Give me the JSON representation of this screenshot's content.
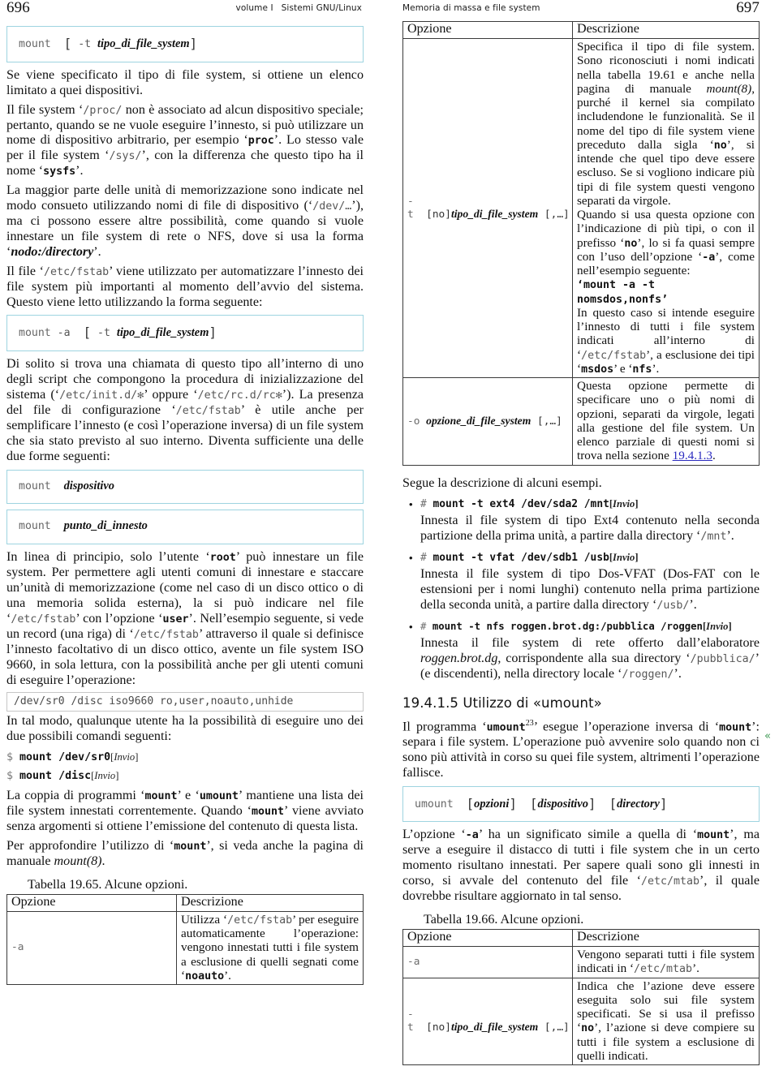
{
  "header": {
    "left_folio": "696",
    "left_title_1": "volume I",
    "left_title_2": "Sistemi GNU/Linux",
    "right_title": "Memoria di massa e file system",
    "right_folio": "697"
  },
  "left_column": {
    "syntax_1": {
      "cmd": "mount",
      "open_bracket": "[",
      "opt": "-t",
      "meta": "tipo_di_file_system",
      "close_bracket": "]"
    },
    "p1": "Se viene specificato il tipo di file system, si ottiene un elenco limitato a quei dispositivi.",
    "p2_a": "Il file system ",
    "p2_fn1": "/proc/",
    "p2_b": " non è associato ad alcun dispositivo speciale; pertanto, quando se ne vuole eseguire l’innesto, si può utilizzare un nome di dispositivo arbitrario, per esempio ‘",
    "p2_kw1": "proc",
    "p2_c": "’. Lo stesso vale per il file system ‘",
    "p2_fn2": "/sys/",
    "p2_d": "’, con la differenza che questo tipo ha il nome ‘",
    "p2_kw2": "sysfs",
    "p2_e": "’.",
    "p3_a": "La maggior parte delle unità di memorizzazione sono indicate nel modo consueto utilizzando nomi di file di dispositivo (‘",
    "p3_fn1": "/dev/…",
    "p3_b": "’), ma ci possono essere altre possibilità, come quando si vuole innestare un file system di rete o NFS, dove si usa la forma ‘",
    "p3_meta": "nodo:/directory",
    "p3_c": "’.",
    "p4_a": "Il file ‘",
    "p4_fn1": "/etc/fstab",
    "p4_b": "’ viene utilizzato per automatizzare l’innesto dei file system più importanti al momento dell’avvio del sistema. Questo viene letto utilizzando la forma seguente:",
    "syntax_2": {
      "cmd": "mount",
      "opt_a": "-a",
      "open_bracket": "[",
      "opt": "-t",
      "meta": "tipo_di_file_system",
      "close_bracket": "]"
    },
    "p5_a": "Di solito si trova una chiamata di questo tipo all’interno di uno degli script che compongono la procedura di inizializzazione del sistema (‘",
    "p5_fn1": "/etc/init.d/✻",
    "p5_b": "’ oppure ‘",
    "p5_fn2": "/etc/rc.d/rc✻",
    "p5_c": "’). La presenza del file di configurazione ‘",
    "p5_fn3": "/etc/fstab",
    "p5_d": "’ è utile anche per semplificare l’innesto (e così l’operazione inversa) di un file system che sia stato previsto al suo interno. Diventa sufficiente una delle due forme seguenti:",
    "syntax_3": {
      "cmd": "mount",
      "meta": "dispositivo"
    },
    "syntax_4": {
      "cmd": "mount",
      "meta": "punto_di_innesto"
    },
    "p6_a": "In linea di principio, solo l’utente ‘",
    "p6_kw1": "root",
    "p6_b": "’ può innestare un file system. Per permettere agli utenti comuni di innestare e staccare un’unità di memorizzazione (come nel caso di un disco ottico o di una memoria solida esterna), la si può indicare nel file ‘",
    "p6_fn1": "/etc/fstab",
    "p6_c": "’ con l’opzione ‘",
    "p6_kw2": "user",
    "p6_d": "’. Nell’esempio seguente, si vede un record (una riga) di ‘",
    "p6_fn2": "/etc/fstab",
    "p6_e": "’ attraverso il quale si definisce l’innesto facoltativo di un disco ottico, avente un file system ISO 9660, in sola lettura, con la possibilità anche per gli utenti comuni di eseguire l’operazione:",
    "fstab_record": "/dev/sr0  /disc  iso9660  ro,user,noauto,unhide",
    "p7": "In tal modo, qualunque utente ha la possibilità di eseguire uno dei due possibili comandi seguenti:",
    "shell_1": {
      "prompt": "$",
      "command": "mount /dev/sr0",
      "key": "Invio"
    },
    "shell_2": {
      "prompt": "$",
      "command": "mount /disc",
      "key": "Invio"
    },
    "p8_a": "La coppia di programmi ‘",
    "p8_kw1": "mount",
    "p8_b": "’ e ‘",
    "p8_kw2": "umount",
    "p8_c": "’ mantiene una lista dei file system innestati correntemente. Quando ‘",
    "p8_kw3": "mount",
    "p8_d": "’ viene avviato senza argomenti si ottiene l’emissione del contenuto di questa lista.",
    "p9_a": "Per approfondire l’utilizzo di ‘",
    "p9_kw1": "mount",
    "p9_b": "’, si veda anche la pagina di manuale ",
    "p9_it": "mount(8)",
    "p9_c": ".",
    "table_caption": "Tabella 19.65. Alcune opzioni.",
    "table": {
      "headers": [
        "Opzione",
        "Descrizione"
      ],
      "rows": [
        {
          "option": "-a",
          "desc_a": "Utilizza ‘",
          "desc_fn": "/etc/fstab",
          "desc_b": "’ per eseguire automaticamente l’operazione: vengono innestati tutti i file system a esclusione di quelli segnati come ‘",
          "desc_kw": "noauto",
          "desc_c": "’."
        }
      ]
    }
  },
  "right_column": {
    "table_top": {
      "headers": [
        "Opzione",
        "Descrizione"
      ],
      "rows": [
        {
          "option_prefix": "-t",
          "option_opt": "[no]",
          "option_meta": "tipo_di_file_system",
          "option_suffix": "[,…]",
          "desc_a": "Specifica il tipo di file system. Sono riconosciuti i nomi indicati nella tabella 19.61 e anche nella pagina di manuale ",
          "desc_it1": "mount(8)",
          "desc_b": ", purché il kernel sia compilato includendone le funzionalità. Se il nome del tipo di file system viene preceduto dalla sigla ‘",
          "desc_kw1": "no",
          "desc_c": "’, si intende che quel tipo deve essere escluso. Se si vogliono indicare più tipi di file system questi vengono separati da virgole.",
          "desc_d": "Quando si usa questa opzione con l’indicazione di più tipi, o con il prefisso ‘",
          "desc_kw2": "no",
          "desc_e": "’, lo si fa quasi sempre con l’uso dell’opzione ‘",
          "desc_kw3": "-a",
          "desc_f": "’, come nell’esempio seguente:",
          "desc_example_1": "‘mount -a -t",
          "desc_example_2": "nomsdos,nonfs’",
          "desc_g": "In questo caso si intende eseguire l’innesto di tutti i file system indicati all’interno di ‘",
          "desc_fn1": "/etc/fstab",
          "desc_h": "’, a esclusione dei tipi ‘",
          "desc_kw4": "msdos",
          "desc_i": "’ e ‘",
          "desc_kw5": "nfs",
          "desc_j": "’."
        },
        {
          "option_prefix": "-o",
          "option_meta": "opzione_di_file_system",
          "option_suffix": "[,…]",
          "desc_a": "Questa opzione permette di specificare uno o più nomi di opzioni, separati da virgole, legati alla gestione del file system. Un elenco parziale di questi nomi si trova nella sezione ",
          "desc_link": "19.4.1.3",
          "desc_b": "."
        }
      ]
    },
    "p1": "Segue la descrizione di alcuni esempi.",
    "examples": [
      {
        "prompt": "#",
        "command": "mount -t ext4 /dev/sda2 /mnt",
        "key": "Invio",
        "body_a": "Innesta il file system di tipo Ext4 contenuto nella seconda partizione della prima unità, a partire dalla directory ‘",
        "body_fn": "/mnt",
        "body_b": "’."
      },
      {
        "prompt": "#",
        "command": "mount -t vfat /dev/sdb1 /usb",
        "key": "Invio",
        "body_a": "Innesta il file system di tipo Dos-VFAT (Dos-FAT con le estensioni per i nomi lunghi) contenuto nella prima partizione della seconda unità, a partire dalla directory ‘",
        "body_fn": "/usb/",
        "body_b": "’."
      },
      {
        "prompt": "#",
        "command": "mount -t nfs roggen.brot.dg:/pubblica /roggen",
        "key": "Invio",
        "body_a": "Innesta il file system di rete offerto dall’elaboratore ",
        "body_it1": "roggen.brot.dg",
        "body_b": ", corrispondente alla sua directory ‘",
        "body_fn1": "/pubblica/",
        "body_c": "’ (e discendenti), nella directory locale ‘",
        "body_fn2": "/roggen/",
        "body_d": "’."
      }
    ],
    "section_heading": "19.4.1.5 Utilizzo di «umount»",
    "margin_mark": "«",
    "p2_a": "Il programma ‘",
    "p2_kw1": "umount",
    "p2_sup": "23",
    "p2_b": "’ esegue l’operazione inversa di ‘",
    "p2_kw2": "mount",
    "p2_c": "’: separa i file system. L’operazione può avvenire solo quando non ci sono più attività in corso su quei file system, altrimenti l’operazione fallisce.",
    "syntax_umount": {
      "cmd": "umount",
      "arg1": "opzioni",
      "arg2": "dispositivo",
      "arg3": "directory"
    },
    "p3_a": "L’opzione ‘",
    "p3_kw1": "-a",
    "p3_b": "’ ha un significato simile a quella di ‘",
    "p3_kw2": "mount",
    "p3_c": "’, ma serve a eseguire il distacco di tutti i file system che in un certo momento risultano innestati. Per sapere quali sono gli innesti in corso, si avvale del contenuto del file ‘",
    "p3_fn1": "/etc/mtab",
    "p3_d": "’, il quale dovrebbe risultare aggiornato in tal senso.",
    "table_caption": "Tabella 19.66. Alcune opzioni.",
    "table_bottom": {
      "headers": [
        "Opzione",
        "Descrizione"
      ],
      "rows": [
        {
          "option": "-a",
          "desc_a": "Vengono separati tutti i file system indicati in ‘",
          "desc_fn": "/etc/mtab",
          "desc_b": "’."
        },
        {
          "option_prefix": "-t",
          "option_opt": "[no]",
          "option_meta": "tipo_di_file_system",
          "option_suffix": "[,…]",
          "desc_a": "Indica che l’azione deve essere eseguita solo sui file system specificati. Se si usa il prefisso ‘",
          "desc_kw1": "no",
          "desc_b": "’, l’azione si deve compiere su tutti i file system a esclusione di quelli indicati."
        }
      ]
    }
  },
  "colors": {
    "syntax_border": "#9ed4e0",
    "mono_grey": "#585858",
    "link": "#2b2bbf",
    "margin_mark": "#3f9a55"
  }
}
